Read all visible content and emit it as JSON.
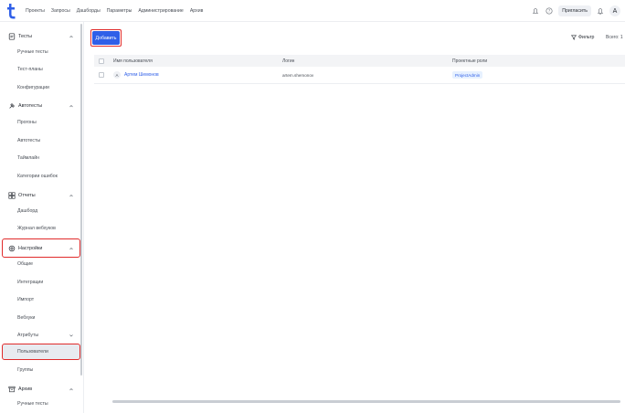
{
  "topbar": {
    "nav": [
      "Проекты",
      "Запросы",
      "Дашборды",
      "Параметры",
      "Администрирование",
      "Архив"
    ],
    "invite_label": "Пригласить",
    "avatar_letter": "A"
  },
  "sidebar": {
    "sections": [
      {
        "label": "Тесты",
        "icon": "tests-icon",
        "items": [
          "Ручные тесты",
          "Тест-планы",
          "Конфигурации"
        ]
      },
      {
        "label": "Автотесты",
        "icon": "autotests-icon",
        "items": [
          "Прогоны",
          "Автотесты",
          "Таймлайн",
          "Категории ошибок"
        ]
      },
      {
        "label": "Отчеты",
        "icon": "reports-icon",
        "items": [
          "Дашборд",
          "Журнал вебхуков"
        ]
      },
      {
        "label": "Настройки",
        "icon": "gear-icon",
        "items": [
          "Общие",
          "Интеграции",
          "Импорт",
          "Вебхуки",
          "Атрибуты",
          "Пользователи",
          "Группы"
        ]
      },
      {
        "label": "Архив",
        "icon": "archive-icon",
        "items": [
          "Ручные тесты"
        ]
      }
    ],
    "active_item": "Пользователи"
  },
  "main": {
    "add_button_label": "Добавить",
    "filter_label": "Фильтр",
    "total_label": "Всего: 1",
    "table": {
      "headers": [
        "Имя пользователя",
        "Логин",
        "Проектные роли"
      ],
      "rows": [
        {
          "avatar": "A",
          "name": "Артем Шемонов",
          "login": "artem.shemonov",
          "role": "ProjectAdmin"
        }
      ]
    }
  },
  "colors": {
    "accent": "#2f5fe8",
    "highlight": "#e02b2b",
    "active_bg": "#e8ebf0"
  }
}
